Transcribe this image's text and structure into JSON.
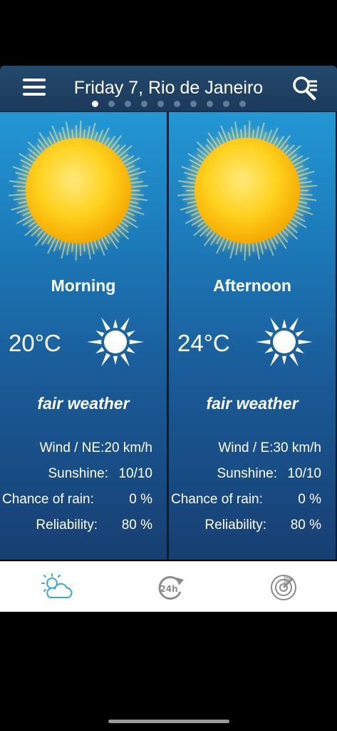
{
  "header": {
    "title": "Friday 7, Rio de Janeiro",
    "menu_icon": "hamburger-menu-icon",
    "search_icon": "location-search-icon",
    "pages": 10,
    "active_page": 1
  },
  "panels": [
    {
      "period": "Morning",
      "temperature": "20°C",
      "condition": "fair weather",
      "icon": "sun-icon",
      "details": [
        {
          "label": "Wind / NE:20 km/h",
          "value": ""
        },
        {
          "label": "Sunshine:",
          "value": "10/10"
        },
        {
          "label": "Chance of rain:",
          "value": "0 %"
        },
        {
          "label": "Reliability:",
          "value": "80 %"
        }
      ]
    },
    {
      "period": "Afternoon",
      "temperature": "24°C",
      "condition": "fair weather",
      "icon": "sun-icon",
      "details": [
        {
          "label": "Wind / E:30 km/h",
          "value": ""
        },
        {
          "label": "Sunshine:",
          "value": "10/10"
        },
        {
          "label": "Chance of rain:",
          "value": "0 %"
        },
        {
          "label": "Reliability:",
          "value": "80 %"
        }
      ]
    }
  ],
  "tabbar": {
    "tabs": [
      {
        "icon": "weather-cloud-sun-icon",
        "active": true
      },
      {
        "icon": "forecast-24h-icon",
        "active": false
      },
      {
        "icon": "radar-icon",
        "active": false
      }
    ]
  },
  "colors": {
    "header_bg": "#1f4266",
    "panel_top": "#2397d4",
    "panel_bottom": "#173f72",
    "active_tab": "#35a6e0",
    "inactive_tab": "#8c8c8c"
  }
}
